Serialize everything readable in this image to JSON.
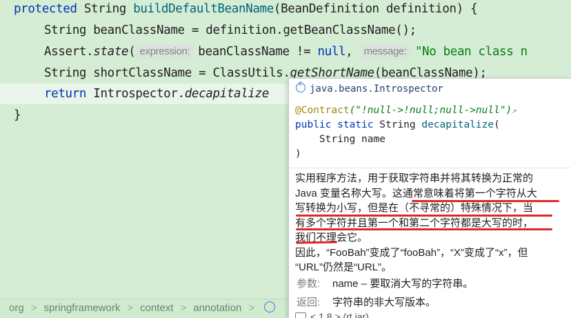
{
  "editor": {
    "line1": {
      "kw": "protected",
      "type": " String ",
      "method": "buildDefaultBeanName",
      "rest": "(BeanDefinition definition) {"
    },
    "line2": {
      "text": "String beanClassName = definition.getBeanClassName();"
    },
    "line3": {
      "obj": "Assert.",
      "method": "state",
      "open": "(",
      "hint1": "expression:",
      "expr": "beanClassName != ",
      "null_kw": "null",
      "comma": ",",
      "hint2": "message:",
      "msg": "\"No bean class n"
    },
    "line4": {
      "a": "String shortClassName = ClassUtils.",
      "method": "getShortName",
      "b": "(beanClassName);"
    },
    "line5": {
      "kw": "return",
      "a": " Introspector.",
      "method": "decapitalize"
    },
    "line6": {
      "text": "}"
    }
  },
  "breadcrumb": {
    "items": [
      "org",
      "springframework",
      "context",
      "annotation"
    ],
    "separator": ">"
  },
  "popup": {
    "package": "java.beans.Introspector",
    "annotation": "@Contract",
    "annotation_value": "(\"!null->!null;null->null\")",
    "ext_link": "↗",
    "sig_line2_kw": "public static",
    "sig_line2_type": " String ",
    "sig_line2_fn": "decapitalize",
    "sig_line2_paren": "(",
    "sig_line3": "    String name",
    "sig_line4": ")",
    "description": [
      "实用程序方法，用于获取字符串并将其转换为正常的",
      "Java 变量名称大写。这通常意味着将第一个字符从大",
      "写转换为小写，但是在（不寻常的）特殊情况下，当",
      "有多个字符并且第一个和第二个字符都是大写的时，",
      "我们不理会它。",
      "因此，“FooBah”变成了“fooBah”，“X”变成了“x”，但",
      "“URL”仍然是“URL”。"
    ],
    "params_label": "参数:",
    "params_value": "name – 要取消大写的字符串。",
    "returns_label": "返回:",
    "returns_value": "字符串的非大写版本。",
    "footer": "< 1.8 > (rt.jar)"
  },
  "colors": {
    "editor_bg": "#d4edd4",
    "keyword": "#0033b3",
    "method": "#00627a",
    "string": "#067d17",
    "underline": "#e0252a"
  }
}
